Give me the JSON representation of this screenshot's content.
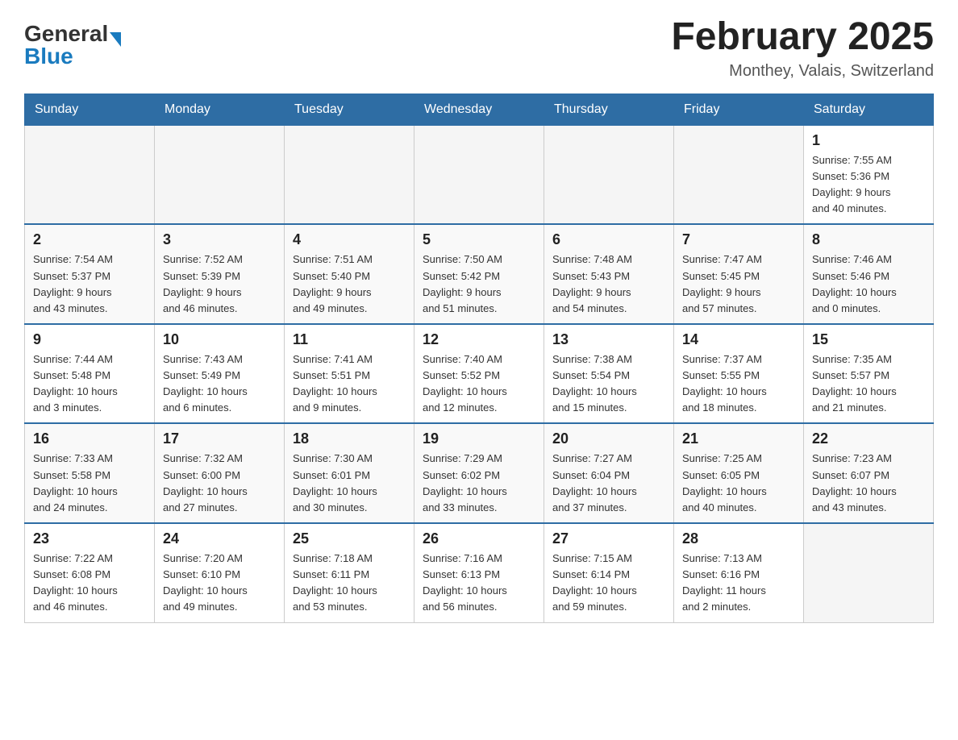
{
  "header": {
    "logo_general": "General",
    "logo_blue": "Blue",
    "title": "February 2025",
    "location": "Monthey, Valais, Switzerland"
  },
  "days_of_week": [
    "Sunday",
    "Monday",
    "Tuesday",
    "Wednesday",
    "Thursday",
    "Friday",
    "Saturday"
  ],
  "weeks": [
    {
      "days": [
        {
          "date": "",
          "info": ""
        },
        {
          "date": "",
          "info": ""
        },
        {
          "date": "",
          "info": ""
        },
        {
          "date": "",
          "info": ""
        },
        {
          "date": "",
          "info": ""
        },
        {
          "date": "",
          "info": ""
        },
        {
          "date": "1",
          "info": "Sunrise: 7:55 AM\nSunset: 5:36 PM\nDaylight: 9 hours\nand 40 minutes."
        }
      ]
    },
    {
      "days": [
        {
          "date": "2",
          "info": "Sunrise: 7:54 AM\nSunset: 5:37 PM\nDaylight: 9 hours\nand 43 minutes."
        },
        {
          "date": "3",
          "info": "Sunrise: 7:52 AM\nSunset: 5:39 PM\nDaylight: 9 hours\nand 46 minutes."
        },
        {
          "date": "4",
          "info": "Sunrise: 7:51 AM\nSunset: 5:40 PM\nDaylight: 9 hours\nand 49 minutes."
        },
        {
          "date": "5",
          "info": "Sunrise: 7:50 AM\nSunset: 5:42 PM\nDaylight: 9 hours\nand 51 minutes."
        },
        {
          "date": "6",
          "info": "Sunrise: 7:48 AM\nSunset: 5:43 PM\nDaylight: 9 hours\nand 54 minutes."
        },
        {
          "date": "7",
          "info": "Sunrise: 7:47 AM\nSunset: 5:45 PM\nDaylight: 9 hours\nand 57 minutes."
        },
        {
          "date": "8",
          "info": "Sunrise: 7:46 AM\nSunset: 5:46 PM\nDaylight: 10 hours\nand 0 minutes."
        }
      ]
    },
    {
      "days": [
        {
          "date": "9",
          "info": "Sunrise: 7:44 AM\nSunset: 5:48 PM\nDaylight: 10 hours\nand 3 minutes."
        },
        {
          "date": "10",
          "info": "Sunrise: 7:43 AM\nSunset: 5:49 PM\nDaylight: 10 hours\nand 6 minutes."
        },
        {
          "date": "11",
          "info": "Sunrise: 7:41 AM\nSunset: 5:51 PM\nDaylight: 10 hours\nand 9 minutes."
        },
        {
          "date": "12",
          "info": "Sunrise: 7:40 AM\nSunset: 5:52 PM\nDaylight: 10 hours\nand 12 minutes."
        },
        {
          "date": "13",
          "info": "Sunrise: 7:38 AM\nSunset: 5:54 PM\nDaylight: 10 hours\nand 15 minutes."
        },
        {
          "date": "14",
          "info": "Sunrise: 7:37 AM\nSunset: 5:55 PM\nDaylight: 10 hours\nand 18 minutes."
        },
        {
          "date": "15",
          "info": "Sunrise: 7:35 AM\nSunset: 5:57 PM\nDaylight: 10 hours\nand 21 minutes."
        }
      ]
    },
    {
      "days": [
        {
          "date": "16",
          "info": "Sunrise: 7:33 AM\nSunset: 5:58 PM\nDaylight: 10 hours\nand 24 minutes."
        },
        {
          "date": "17",
          "info": "Sunrise: 7:32 AM\nSunset: 6:00 PM\nDaylight: 10 hours\nand 27 minutes."
        },
        {
          "date": "18",
          "info": "Sunrise: 7:30 AM\nSunset: 6:01 PM\nDaylight: 10 hours\nand 30 minutes."
        },
        {
          "date": "19",
          "info": "Sunrise: 7:29 AM\nSunset: 6:02 PM\nDaylight: 10 hours\nand 33 minutes."
        },
        {
          "date": "20",
          "info": "Sunrise: 7:27 AM\nSunset: 6:04 PM\nDaylight: 10 hours\nand 37 minutes."
        },
        {
          "date": "21",
          "info": "Sunrise: 7:25 AM\nSunset: 6:05 PM\nDaylight: 10 hours\nand 40 minutes."
        },
        {
          "date": "22",
          "info": "Sunrise: 7:23 AM\nSunset: 6:07 PM\nDaylight: 10 hours\nand 43 minutes."
        }
      ]
    },
    {
      "days": [
        {
          "date": "23",
          "info": "Sunrise: 7:22 AM\nSunset: 6:08 PM\nDaylight: 10 hours\nand 46 minutes."
        },
        {
          "date": "24",
          "info": "Sunrise: 7:20 AM\nSunset: 6:10 PM\nDaylight: 10 hours\nand 49 minutes."
        },
        {
          "date": "25",
          "info": "Sunrise: 7:18 AM\nSunset: 6:11 PM\nDaylight: 10 hours\nand 53 minutes."
        },
        {
          "date": "26",
          "info": "Sunrise: 7:16 AM\nSunset: 6:13 PM\nDaylight: 10 hours\nand 56 minutes."
        },
        {
          "date": "27",
          "info": "Sunrise: 7:15 AM\nSunset: 6:14 PM\nDaylight: 10 hours\nand 59 minutes."
        },
        {
          "date": "28",
          "info": "Sunrise: 7:13 AM\nSunset: 6:16 PM\nDaylight: 11 hours\nand 2 minutes."
        },
        {
          "date": "",
          "info": ""
        }
      ]
    }
  ]
}
